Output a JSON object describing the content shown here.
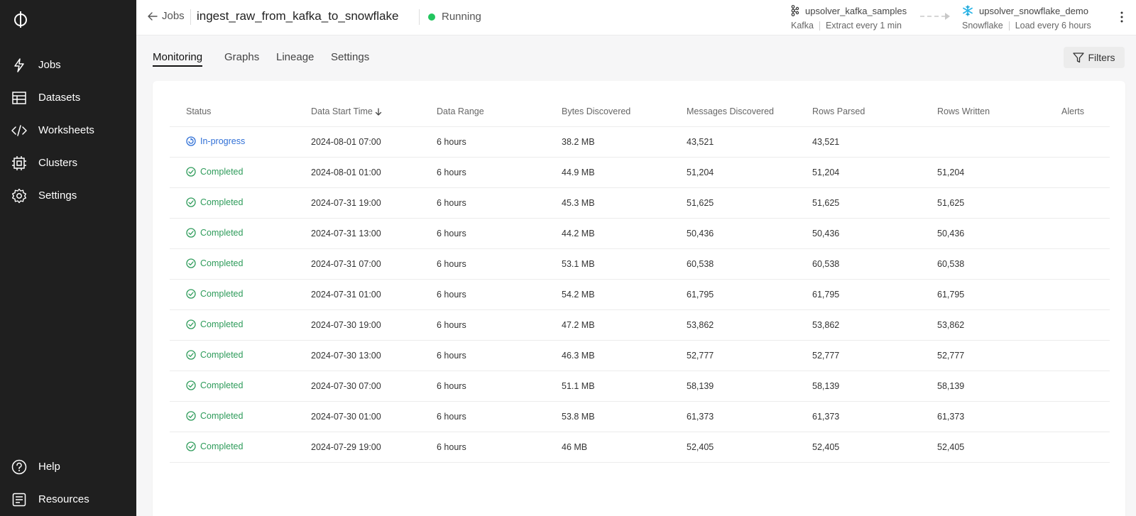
{
  "sidebar": {
    "items": [
      {
        "label": "Jobs",
        "icon": "bolt-icon"
      },
      {
        "label": "Datasets",
        "icon": "table-icon"
      },
      {
        "label": "Worksheets",
        "icon": "code-icon"
      },
      {
        "label": "Clusters",
        "icon": "chip-icon"
      },
      {
        "label": "Settings",
        "icon": "gear-icon"
      }
    ],
    "bottom_items": [
      {
        "label": "Help",
        "icon": "help-icon"
      },
      {
        "label": "Resources",
        "icon": "document-icon"
      }
    ]
  },
  "header": {
    "back_label": "Jobs",
    "job_name": "ingest_raw_from_kafka_to_snowflake",
    "status": "Running",
    "status_color": "#22c55e",
    "source": {
      "name": "upsolver_kafka_samples",
      "type": "Kafka",
      "schedule": "Extract every 1 min"
    },
    "target": {
      "name": "upsolver_snowflake_demo",
      "type": "Snowflake",
      "schedule": "Load every 6 hours"
    }
  },
  "tabs": [
    {
      "label": "Monitoring",
      "active": true
    },
    {
      "label": "Graphs",
      "active": false
    },
    {
      "label": "Lineage",
      "active": false
    },
    {
      "label": "Settings",
      "active": false
    }
  ],
  "filters_label": "Filters",
  "table": {
    "columns": [
      "Status",
      "Data Start Time",
      "Data Range",
      "Bytes Discovered",
      "Messages Discovered",
      "Rows Parsed",
      "Rows Written",
      "Alerts"
    ],
    "sort_column": "Data Start Time",
    "rows": [
      {
        "status": "In-progress",
        "start": "2024-08-01 07:00",
        "range": "6 hours",
        "bytes": "38.2 MB",
        "messages": "43,521",
        "parsed": "43,521",
        "written": "",
        "alerts": ""
      },
      {
        "status": "Completed",
        "start": "2024-08-01 01:00",
        "range": "6 hours",
        "bytes": "44.9 MB",
        "messages": "51,204",
        "parsed": "51,204",
        "written": "51,204",
        "alerts": ""
      },
      {
        "status": "Completed",
        "start": "2024-07-31 19:00",
        "range": "6 hours",
        "bytes": "45.3 MB",
        "messages": "51,625",
        "parsed": "51,625",
        "written": "51,625",
        "alerts": ""
      },
      {
        "status": "Completed",
        "start": "2024-07-31 13:00",
        "range": "6 hours",
        "bytes": "44.2 MB",
        "messages": "50,436",
        "parsed": "50,436",
        "written": "50,436",
        "alerts": ""
      },
      {
        "status": "Completed",
        "start": "2024-07-31 07:00",
        "range": "6 hours",
        "bytes": "53.1 MB",
        "messages": "60,538",
        "parsed": "60,538",
        "written": "60,538",
        "alerts": ""
      },
      {
        "status": "Completed",
        "start": "2024-07-31 01:00",
        "range": "6 hours",
        "bytes": "54.2 MB",
        "messages": "61,795",
        "parsed": "61,795",
        "written": "61,795",
        "alerts": ""
      },
      {
        "status": "Completed",
        "start": "2024-07-30 19:00",
        "range": "6 hours",
        "bytes": "47.2 MB",
        "messages": "53,862",
        "parsed": "53,862",
        "written": "53,862",
        "alerts": ""
      },
      {
        "status": "Completed",
        "start": "2024-07-30 13:00",
        "range": "6 hours",
        "bytes": "46.3 MB",
        "messages": "52,777",
        "parsed": "52,777",
        "written": "52,777",
        "alerts": ""
      },
      {
        "status": "Completed",
        "start": "2024-07-30 07:00",
        "range": "6 hours",
        "bytes": "51.1 MB",
        "messages": "58,139",
        "parsed": "58,139",
        "written": "58,139",
        "alerts": ""
      },
      {
        "status": "Completed",
        "start": "2024-07-30 01:00",
        "range": "6 hours",
        "bytes": "53.8 MB",
        "messages": "61,373",
        "parsed": "61,373",
        "written": "61,373",
        "alerts": ""
      },
      {
        "status": "Completed",
        "start": "2024-07-29 19:00",
        "range": "6 hours",
        "bytes": "46 MB",
        "messages": "52,405",
        "parsed": "52,405",
        "written": "52,405",
        "alerts": ""
      }
    ]
  },
  "colors": {
    "completed": "#2e9b5a",
    "in_progress": "#2f6fd6",
    "sidebar_bg": "#1f1f1f"
  }
}
